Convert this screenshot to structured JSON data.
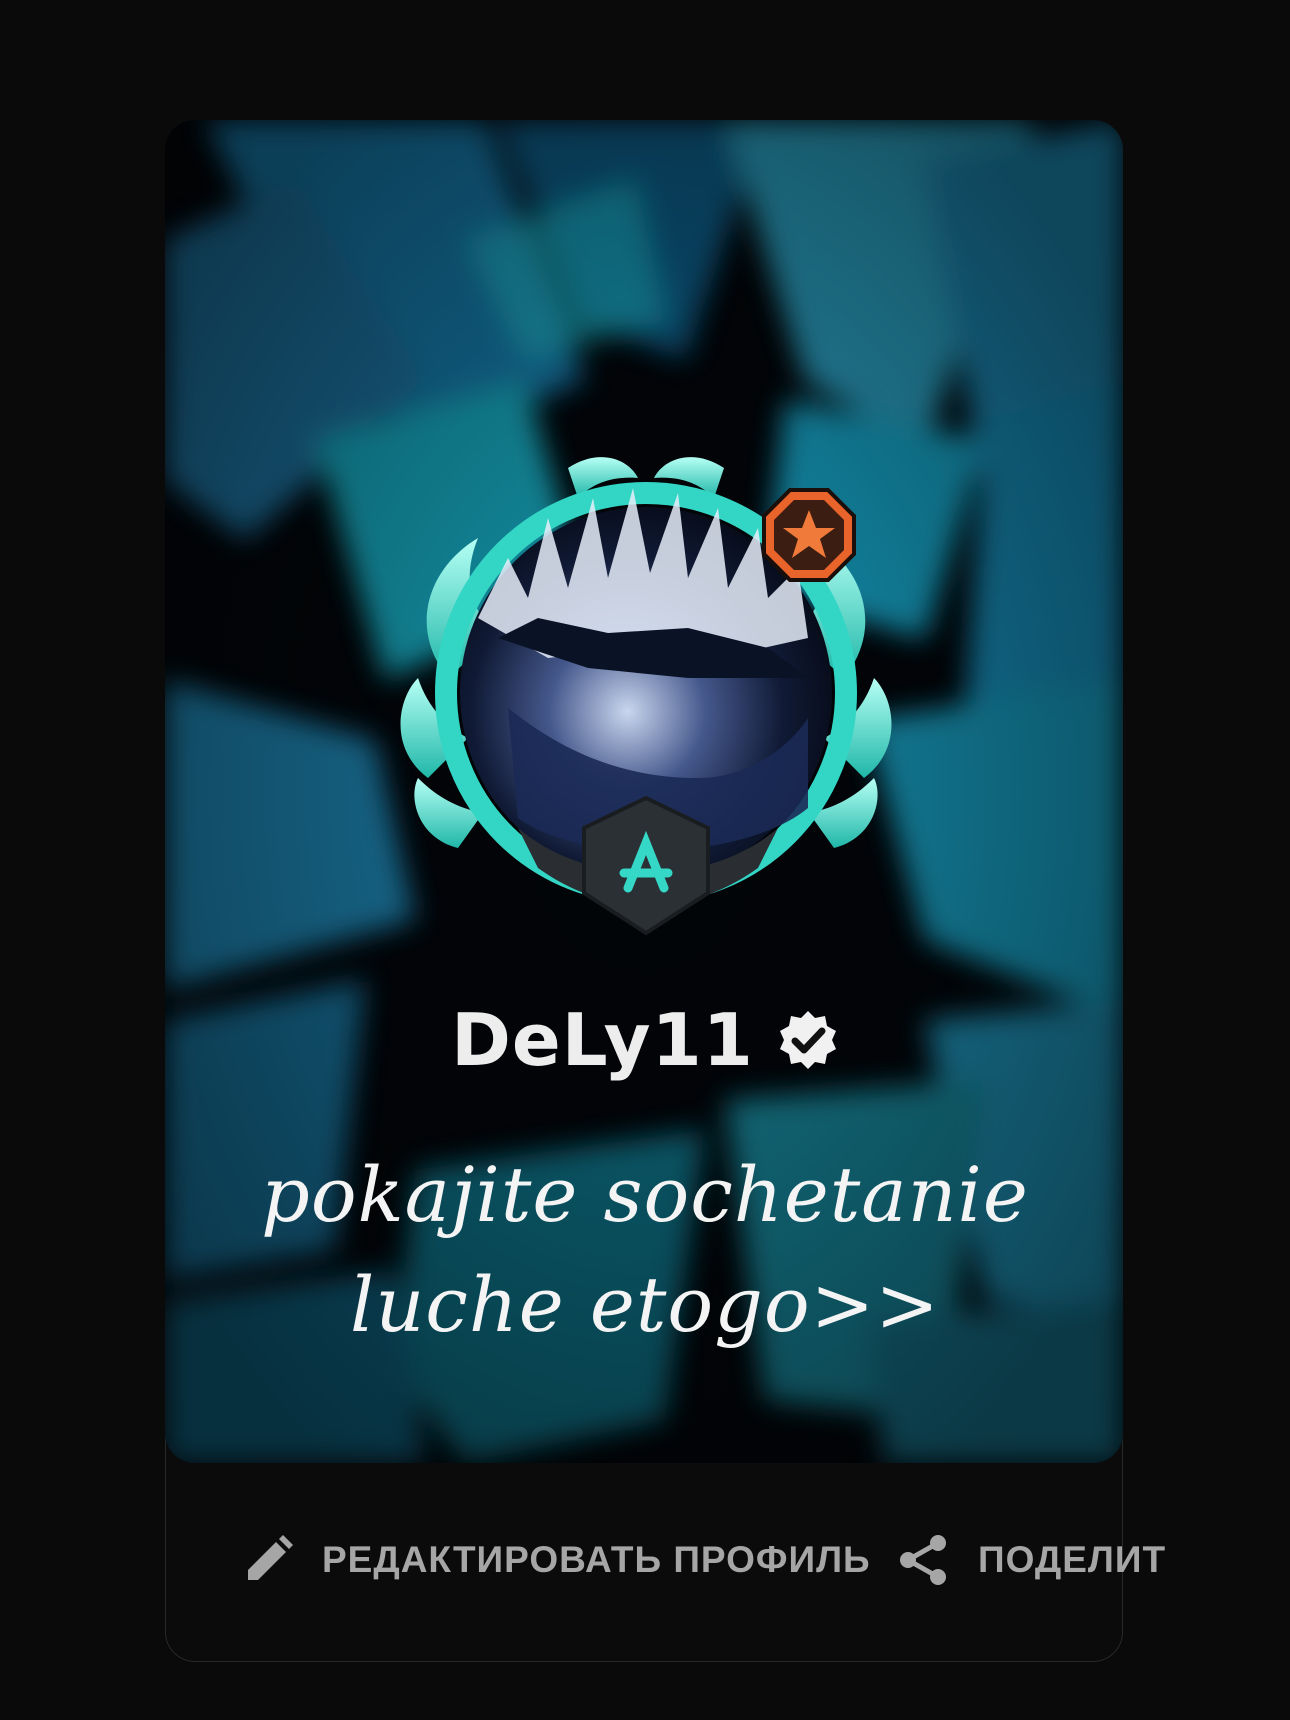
{
  "profile": {
    "username": "DeLy11",
    "verified": true,
    "bio_line1": "pokajite sochetanie",
    "bio_line2": "luche etogo>>"
  },
  "actions": {
    "edit_label": "РЕДАКТИРОВАТЬ ПРОФИЛЬ",
    "share_label": "ПОДЕЛИТ"
  },
  "icons": {
    "edit": "pencil-icon",
    "share": "share-icon",
    "verified": "verified-badge-icon",
    "rank": "rank-star-icon"
  },
  "colors": {
    "background": "#0a0a0b",
    "accent_teal": "#2fd3c7",
    "rank_orange": "#e8642a",
    "action_text": "#a6a6a6"
  }
}
